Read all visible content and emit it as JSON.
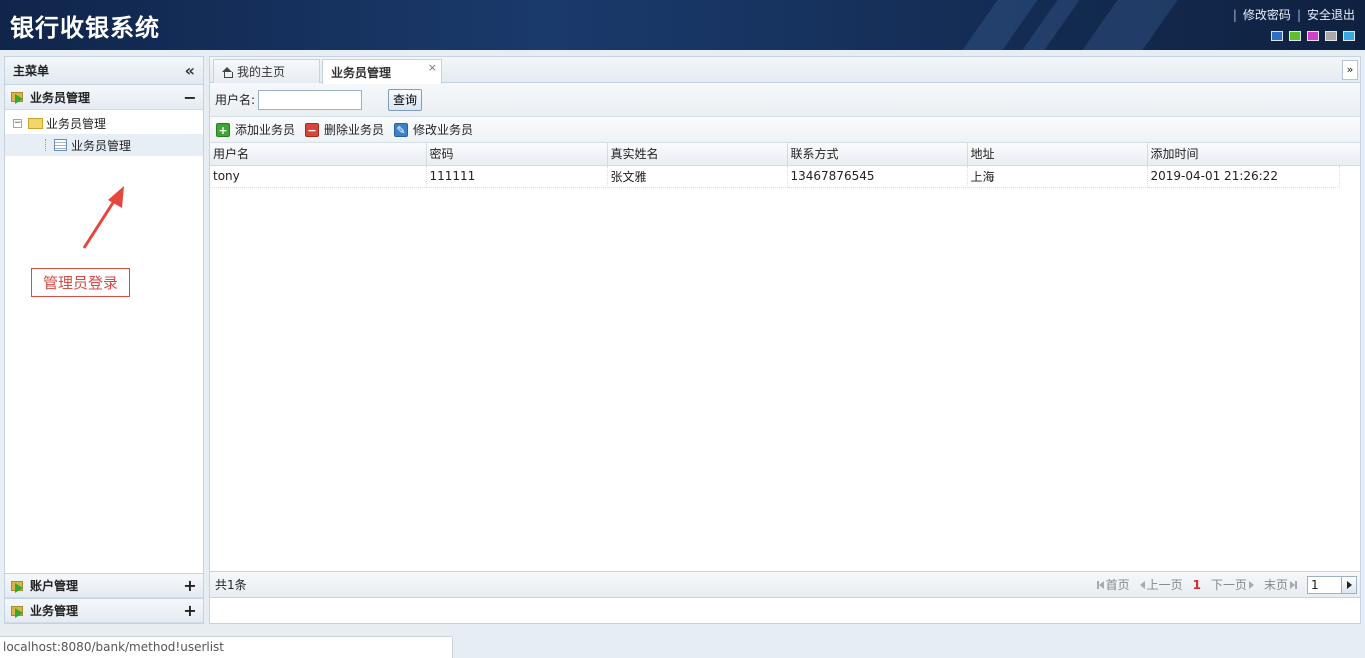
{
  "header": {
    "title": "银行收银系统",
    "links": {
      "change_password": "修改密码",
      "logout": "安全退出"
    },
    "themes": [
      "#2e6fc4",
      "#5fbf2a",
      "#d23fc9",
      "#a9a9a9",
      "#39a8e0"
    ]
  },
  "sidebar": {
    "title": "主菜单",
    "sections": [
      {
        "label": "业务员管理",
        "state": "−"
      },
      {
        "label": "账户管理",
        "state": "+"
      },
      {
        "label": "业务管理",
        "state": "+"
      }
    ],
    "tree": {
      "toggle": "−",
      "folder_label": "业务员管理",
      "child_label": "业务员管理"
    }
  },
  "annotation": {
    "text": "管理员登录",
    "color": "#d94a44"
  },
  "tabs": [
    {
      "label": "我的主页"
    },
    {
      "label": "业务员管理",
      "close": "×"
    }
  ],
  "search": {
    "label": "用户名:",
    "value": "",
    "placeholder": "",
    "button": "查询"
  },
  "toolbar": {
    "add": "添加业务员",
    "delete": "删除业务员",
    "edit": "修改业务员"
  },
  "table": {
    "columns": [
      "用户名",
      "密码",
      "真实姓名",
      "联系方式",
      "地址",
      "添加时间"
    ],
    "rows": [
      [
        "tony",
        "111111",
        "张文雅",
        "13467876545",
        "上海",
        "2019-04-01 21:26:22"
      ]
    ]
  },
  "pager": {
    "total": "共1条",
    "first": "首页",
    "prev": "上一页",
    "current": "1",
    "next": "下一页",
    "last": "末页",
    "page_input": "1"
  },
  "statusbar": {
    "url": "localhost:8080/bank/method!userlist"
  }
}
